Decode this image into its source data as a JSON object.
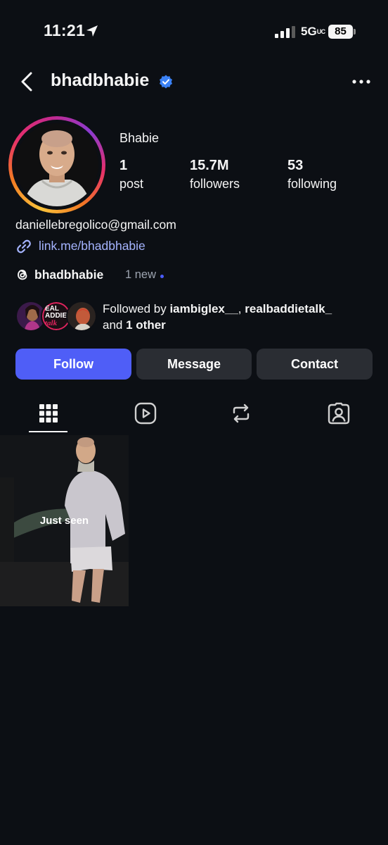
{
  "status_bar": {
    "time": "11:21",
    "network": "5G",
    "network_suffix": "UC",
    "battery": "85"
  },
  "header": {
    "username": "bhadbhabie",
    "verified": true
  },
  "profile": {
    "display_name": "Bhabie",
    "stats": [
      {
        "value": "1",
        "label": "post"
      },
      {
        "value": "15.7M",
        "label": "followers"
      },
      {
        "value": "53",
        "label": "following"
      }
    ],
    "email": "daniellebregolico@gmail.com",
    "link": "link.me/bhadbhabie",
    "threads": {
      "handle": "bhadbhabie",
      "badge": "1 new"
    },
    "followed_by": {
      "prefix": "Followed by",
      "user1": "iambiglex__",
      "separator": ",",
      "user2": "realbaddietalk_",
      "and": "and",
      "others": "1 other"
    },
    "mini_avatar_text": {
      "line1": "EAL",
      "line2": "ADDIE",
      "line3": "talk"
    }
  },
  "actions": {
    "follow": "Follow",
    "message": "Message",
    "contact": "Contact"
  },
  "tabs": [
    "grid",
    "reels",
    "reposts",
    "tagged"
  ],
  "posts": [
    {
      "caption": "Just seen"
    }
  ],
  "colors": {
    "background": "#0c0f14",
    "accent": "#4f5ef7",
    "link": "#a5b4ff",
    "secondary_button": "#2a2d33",
    "verified": "#3b82f6"
  },
  "icons": {
    "location": "location-arrow-icon",
    "signal": "cell-signal-icon",
    "back": "chevron-left-icon",
    "verified": "verified-badge-icon",
    "more": "more-horizontal-icon",
    "link": "link-icon",
    "threads": "threads-icon",
    "grid": "grid-icon",
    "reels": "reels-icon",
    "reposts": "repost-icon",
    "tagged": "tagged-person-icon"
  }
}
